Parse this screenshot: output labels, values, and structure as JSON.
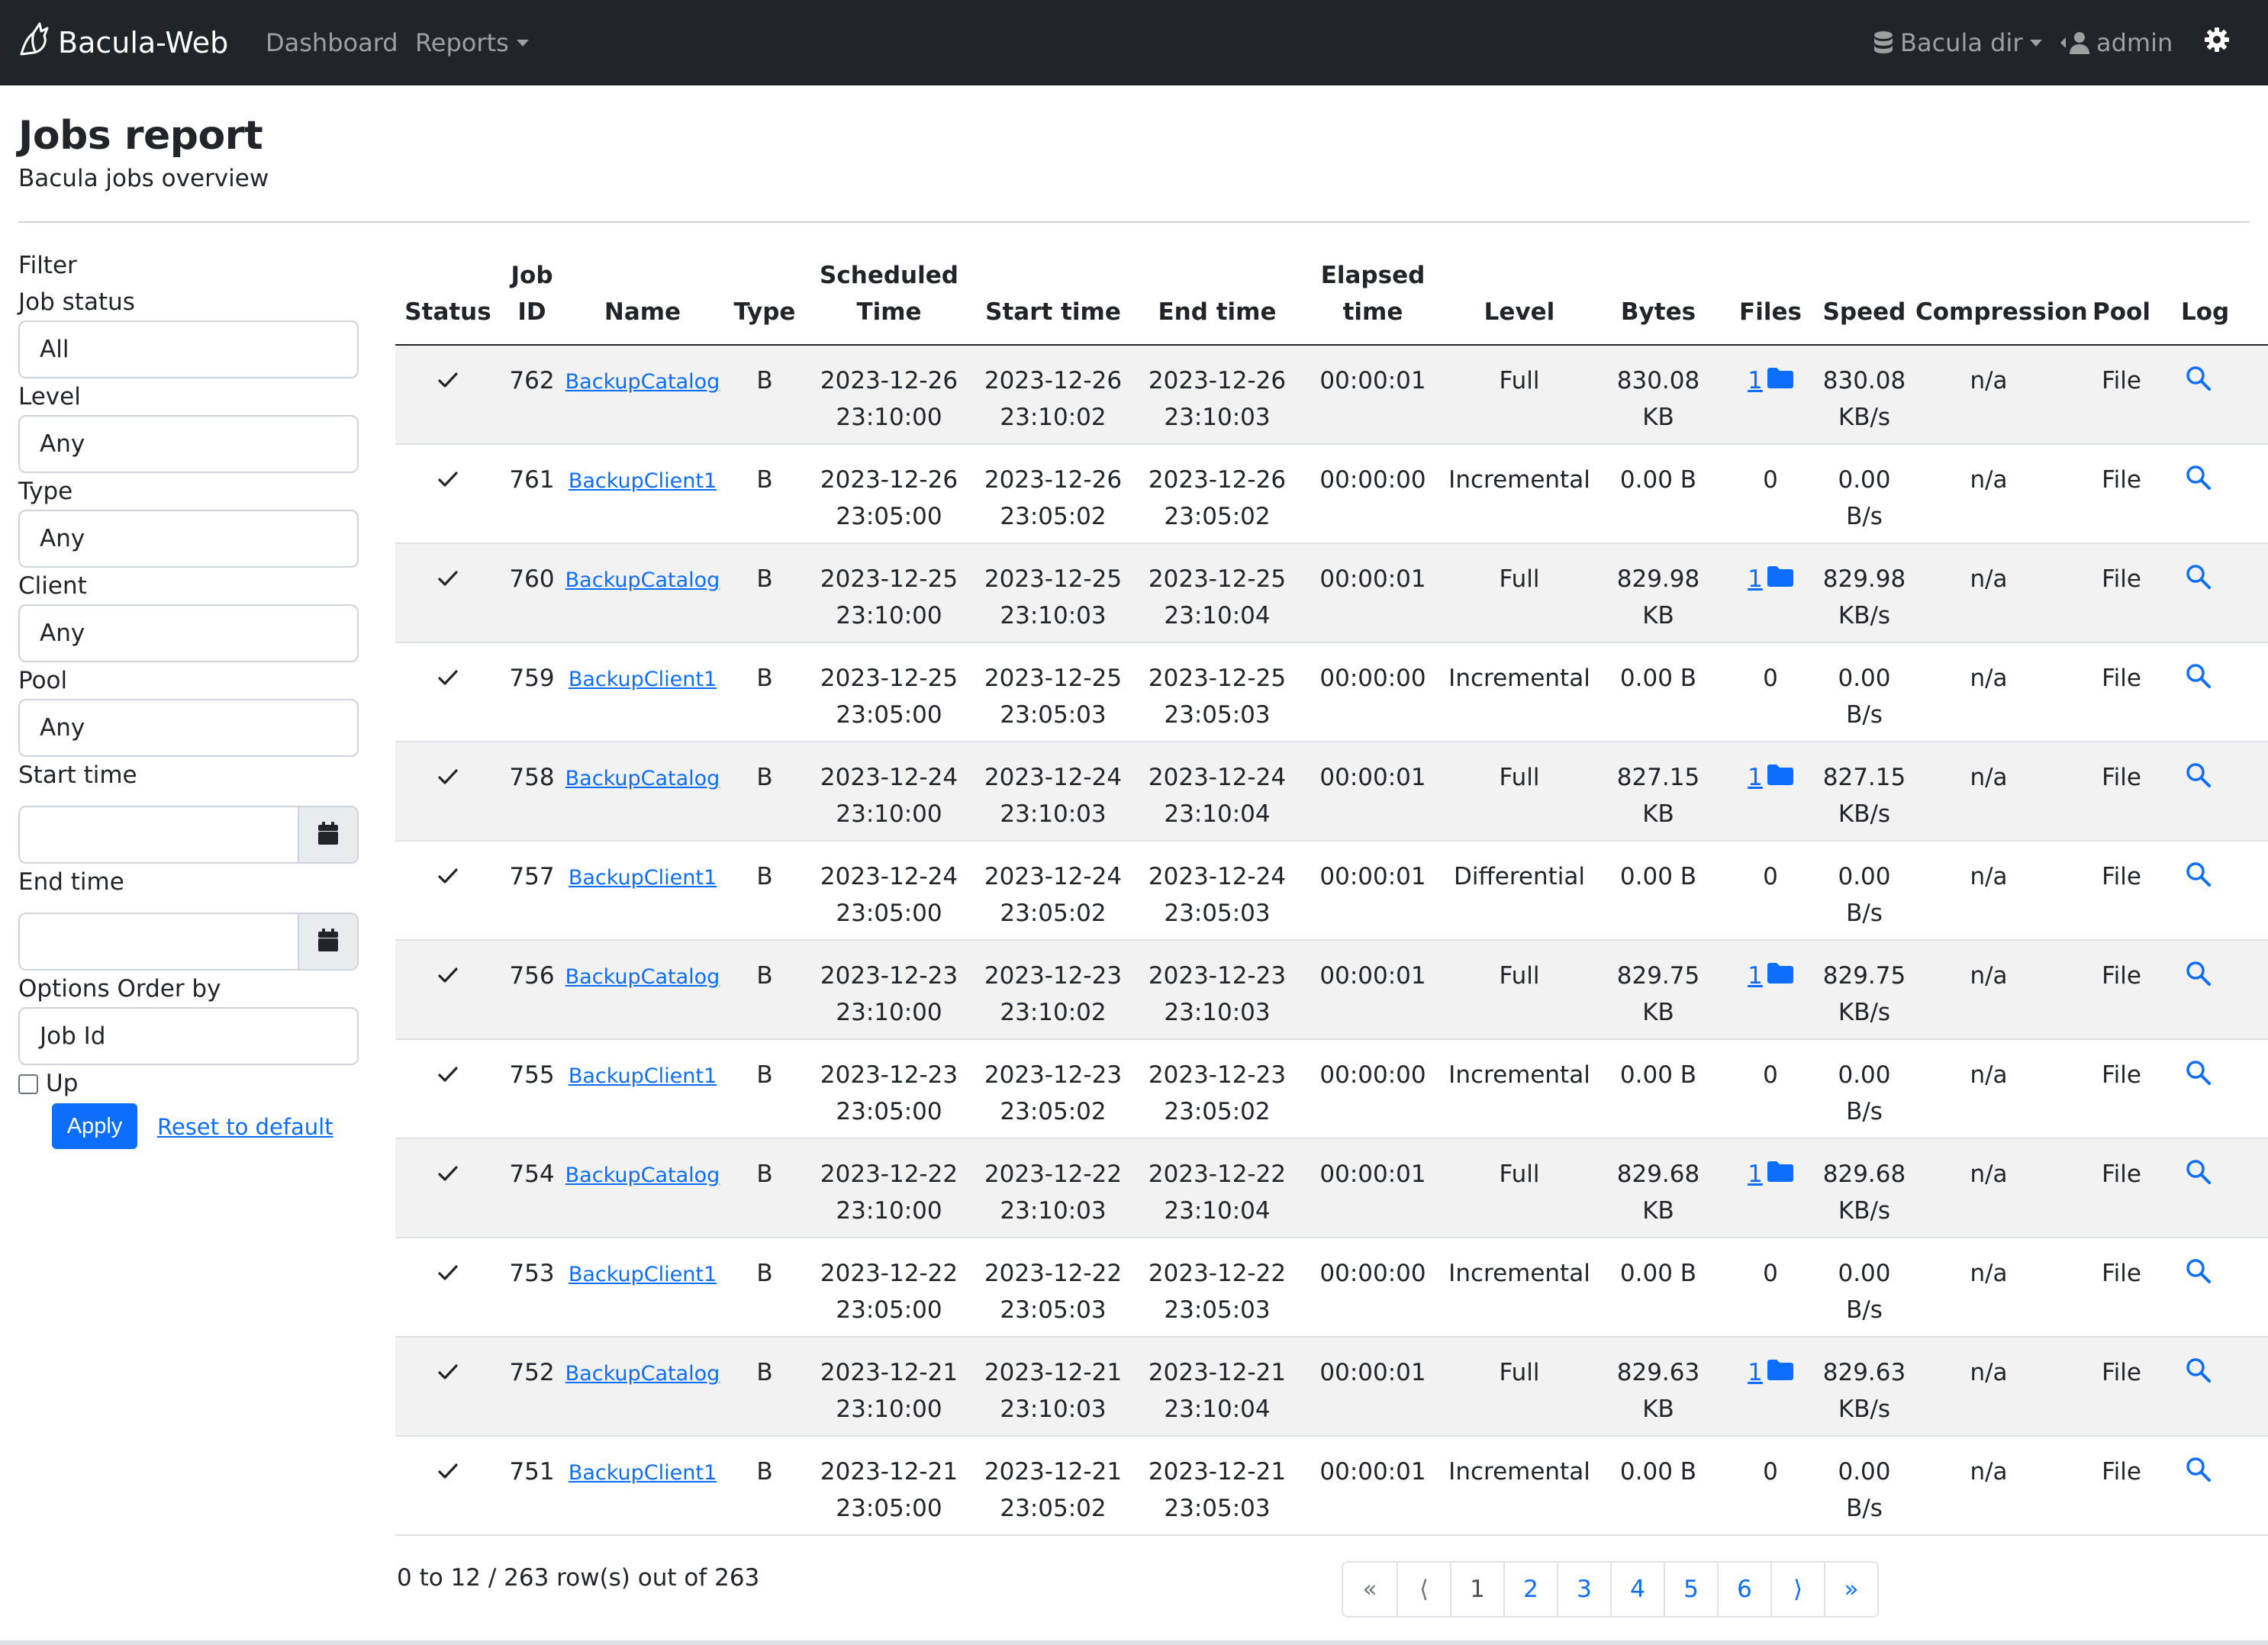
{
  "navbar": {
    "brand": "Bacula-Web",
    "links": {
      "dashboard": "Dashboard",
      "reports": "Reports"
    },
    "director": "Bacula dir",
    "user": "admin"
  },
  "header": {
    "title": "Jobs report",
    "subtitle": "Bacula jobs overview"
  },
  "filter": {
    "heading": "Filter",
    "job_status": {
      "label": "Job status",
      "value": "All"
    },
    "level": {
      "label": "Level",
      "value": "Any"
    },
    "type": {
      "label": "Type",
      "value": "Any"
    },
    "client": {
      "label": "Client",
      "value": "Any"
    },
    "pool": {
      "label": "Pool",
      "value": "Any"
    },
    "start_time": {
      "label": "Start time",
      "value": ""
    },
    "end_time": {
      "label": "End time",
      "value": ""
    },
    "order_by": {
      "label": "Options Order by",
      "value": "Job Id"
    },
    "up_label": "Up",
    "apply": "Apply",
    "reset": "Reset to default"
  },
  "table": {
    "headers": {
      "status": "Status",
      "jobid_1": "Job",
      "jobid_2": "ID",
      "name": "Name",
      "type": "Type",
      "scheduled_1": "Scheduled",
      "scheduled_2": "Time",
      "start": "Start time",
      "end": "End time",
      "elapsed_1": "Elapsed",
      "elapsed_2": "time",
      "level": "Level",
      "bytes": "Bytes",
      "files": "Files",
      "speed": "Speed",
      "compression": "Compression",
      "pool": "Pool",
      "log": "Log"
    },
    "rows": [
      {
        "status": "✓",
        "id": "762",
        "name": "BackupCatalog",
        "type": "B",
        "sched_d": "2023-12-26",
        "sched_t": "23:10:00",
        "start_d": "2023-12-26",
        "start_t": "23:10:02",
        "end_d": "2023-12-26",
        "end_t": "23:10:03",
        "elapsed": "00:00:01",
        "level": "Full",
        "bytes_1": "830.08",
        "bytes_2": "KB",
        "files": "1",
        "speed_1": "830.08",
        "speed_2": "KB/s",
        "compression": "n/a",
        "pool": "File"
      },
      {
        "status": "✓",
        "id": "761",
        "name": "BackupClient1",
        "type": "B",
        "sched_d": "2023-12-26",
        "sched_t": "23:05:00",
        "start_d": "2023-12-26",
        "start_t": "23:05:02",
        "end_d": "2023-12-26",
        "end_t": "23:05:02",
        "elapsed": "00:00:00",
        "level": "Incremental",
        "bytes_1": "0.00 B",
        "bytes_2": "",
        "files": "0",
        "speed_1": "0.00",
        "speed_2": "B/s",
        "compression": "n/a",
        "pool": "File"
      },
      {
        "status": "✓",
        "id": "760",
        "name": "BackupCatalog",
        "type": "B",
        "sched_d": "2023-12-25",
        "sched_t": "23:10:00",
        "start_d": "2023-12-25",
        "start_t": "23:10:03",
        "end_d": "2023-12-25",
        "end_t": "23:10:04",
        "elapsed": "00:00:01",
        "level": "Full",
        "bytes_1": "829.98",
        "bytes_2": "KB",
        "files": "1",
        "speed_1": "829.98",
        "speed_2": "KB/s",
        "compression": "n/a",
        "pool": "File"
      },
      {
        "status": "✓",
        "id": "759",
        "name": "BackupClient1",
        "type": "B",
        "sched_d": "2023-12-25",
        "sched_t": "23:05:00",
        "start_d": "2023-12-25",
        "start_t": "23:05:03",
        "end_d": "2023-12-25",
        "end_t": "23:05:03",
        "elapsed": "00:00:00",
        "level": "Incremental",
        "bytes_1": "0.00 B",
        "bytes_2": "",
        "files": "0",
        "speed_1": "0.00",
        "speed_2": "B/s",
        "compression": "n/a",
        "pool": "File"
      },
      {
        "status": "✓",
        "id": "758",
        "name": "BackupCatalog",
        "type": "B",
        "sched_d": "2023-12-24",
        "sched_t": "23:10:00",
        "start_d": "2023-12-24",
        "start_t": "23:10:03",
        "end_d": "2023-12-24",
        "end_t": "23:10:04",
        "elapsed": "00:00:01",
        "level": "Full",
        "bytes_1": "827.15",
        "bytes_2": "KB",
        "files": "1",
        "speed_1": "827.15",
        "speed_2": "KB/s",
        "compression": "n/a",
        "pool": "File"
      },
      {
        "status": "✓",
        "id": "757",
        "name": "BackupClient1",
        "type": "B",
        "sched_d": "2023-12-24",
        "sched_t": "23:05:00",
        "start_d": "2023-12-24",
        "start_t": "23:05:02",
        "end_d": "2023-12-24",
        "end_t": "23:05:03",
        "elapsed": "00:00:01",
        "level": "Differential",
        "bytes_1": "0.00 B",
        "bytes_2": "",
        "files": "0",
        "speed_1": "0.00",
        "speed_2": "B/s",
        "compression": "n/a",
        "pool": "File"
      },
      {
        "status": "✓",
        "id": "756",
        "name": "BackupCatalog",
        "type": "B",
        "sched_d": "2023-12-23",
        "sched_t": "23:10:00",
        "start_d": "2023-12-23",
        "start_t": "23:10:02",
        "end_d": "2023-12-23",
        "end_t": "23:10:03",
        "elapsed": "00:00:01",
        "level": "Full",
        "bytes_1": "829.75",
        "bytes_2": "KB",
        "files": "1",
        "speed_1": "829.75",
        "speed_2": "KB/s",
        "compression": "n/a",
        "pool": "File"
      },
      {
        "status": "✓",
        "id": "755",
        "name": "BackupClient1",
        "type": "B",
        "sched_d": "2023-12-23",
        "sched_t": "23:05:00",
        "start_d": "2023-12-23",
        "start_t": "23:05:02",
        "end_d": "2023-12-23",
        "end_t": "23:05:02",
        "elapsed": "00:00:00",
        "level": "Incremental",
        "bytes_1": "0.00 B",
        "bytes_2": "",
        "files": "0",
        "speed_1": "0.00",
        "speed_2": "B/s",
        "compression": "n/a",
        "pool": "File"
      },
      {
        "status": "✓",
        "id": "754",
        "name": "BackupCatalog",
        "type": "B",
        "sched_d": "2023-12-22",
        "sched_t": "23:10:00",
        "start_d": "2023-12-22",
        "start_t": "23:10:03",
        "end_d": "2023-12-22",
        "end_t": "23:10:04",
        "elapsed": "00:00:01",
        "level": "Full",
        "bytes_1": "829.68",
        "bytes_2": "KB",
        "files": "1",
        "speed_1": "829.68",
        "speed_2": "KB/s",
        "compression": "n/a",
        "pool": "File"
      },
      {
        "status": "✓",
        "id": "753",
        "name": "BackupClient1",
        "type": "B",
        "sched_d": "2023-12-22",
        "sched_t": "23:05:00",
        "start_d": "2023-12-22",
        "start_t": "23:05:03",
        "end_d": "2023-12-22",
        "end_t": "23:05:03",
        "elapsed": "00:00:00",
        "level": "Incremental",
        "bytes_1": "0.00 B",
        "bytes_2": "",
        "files": "0",
        "speed_1": "0.00",
        "speed_2": "B/s",
        "compression": "n/a",
        "pool": "File"
      },
      {
        "status": "✓",
        "id": "752",
        "name": "BackupCatalog",
        "type": "B",
        "sched_d": "2023-12-21",
        "sched_t": "23:10:00",
        "start_d": "2023-12-21",
        "start_t": "23:10:03",
        "end_d": "2023-12-21",
        "end_t": "23:10:04",
        "elapsed": "00:00:01",
        "level": "Full",
        "bytes_1": "829.63",
        "bytes_2": "KB",
        "files": "1",
        "speed_1": "829.63",
        "speed_2": "KB/s",
        "compression": "n/a",
        "pool": "File"
      },
      {
        "status": "✓",
        "id": "751",
        "name": "BackupClient1",
        "type": "B",
        "sched_d": "2023-12-21",
        "sched_t": "23:05:00",
        "start_d": "2023-12-21",
        "start_t": "23:05:02",
        "end_d": "2023-12-21",
        "end_t": "23:05:03",
        "elapsed": "00:00:01",
        "level": "Incremental",
        "bytes_1": "0.00 B",
        "bytes_2": "",
        "files": "0",
        "speed_1": "0.00",
        "speed_2": "B/s",
        "compression": "n/a",
        "pool": "File"
      }
    ]
  },
  "footer": {
    "row_info": "0 to 12 / 263 row(s) out of 263",
    "pages": [
      "«",
      "⟨",
      "1",
      "2",
      "3",
      "4",
      "5",
      "6",
      "⟩",
      "»"
    ],
    "current_page": "1"
  },
  "colors": {
    "navbar_bg": "#212529",
    "link": "#0d6efd",
    "stripe": "#f2f2f2"
  },
  "icons": {
    "brand": "bird-icon",
    "director": "database-icon",
    "user": "user-icon",
    "settings": "gear-icon",
    "calendar": "calendar-icon",
    "files": "folder-icon",
    "log": "search-icon",
    "status": "check-icon"
  }
}
